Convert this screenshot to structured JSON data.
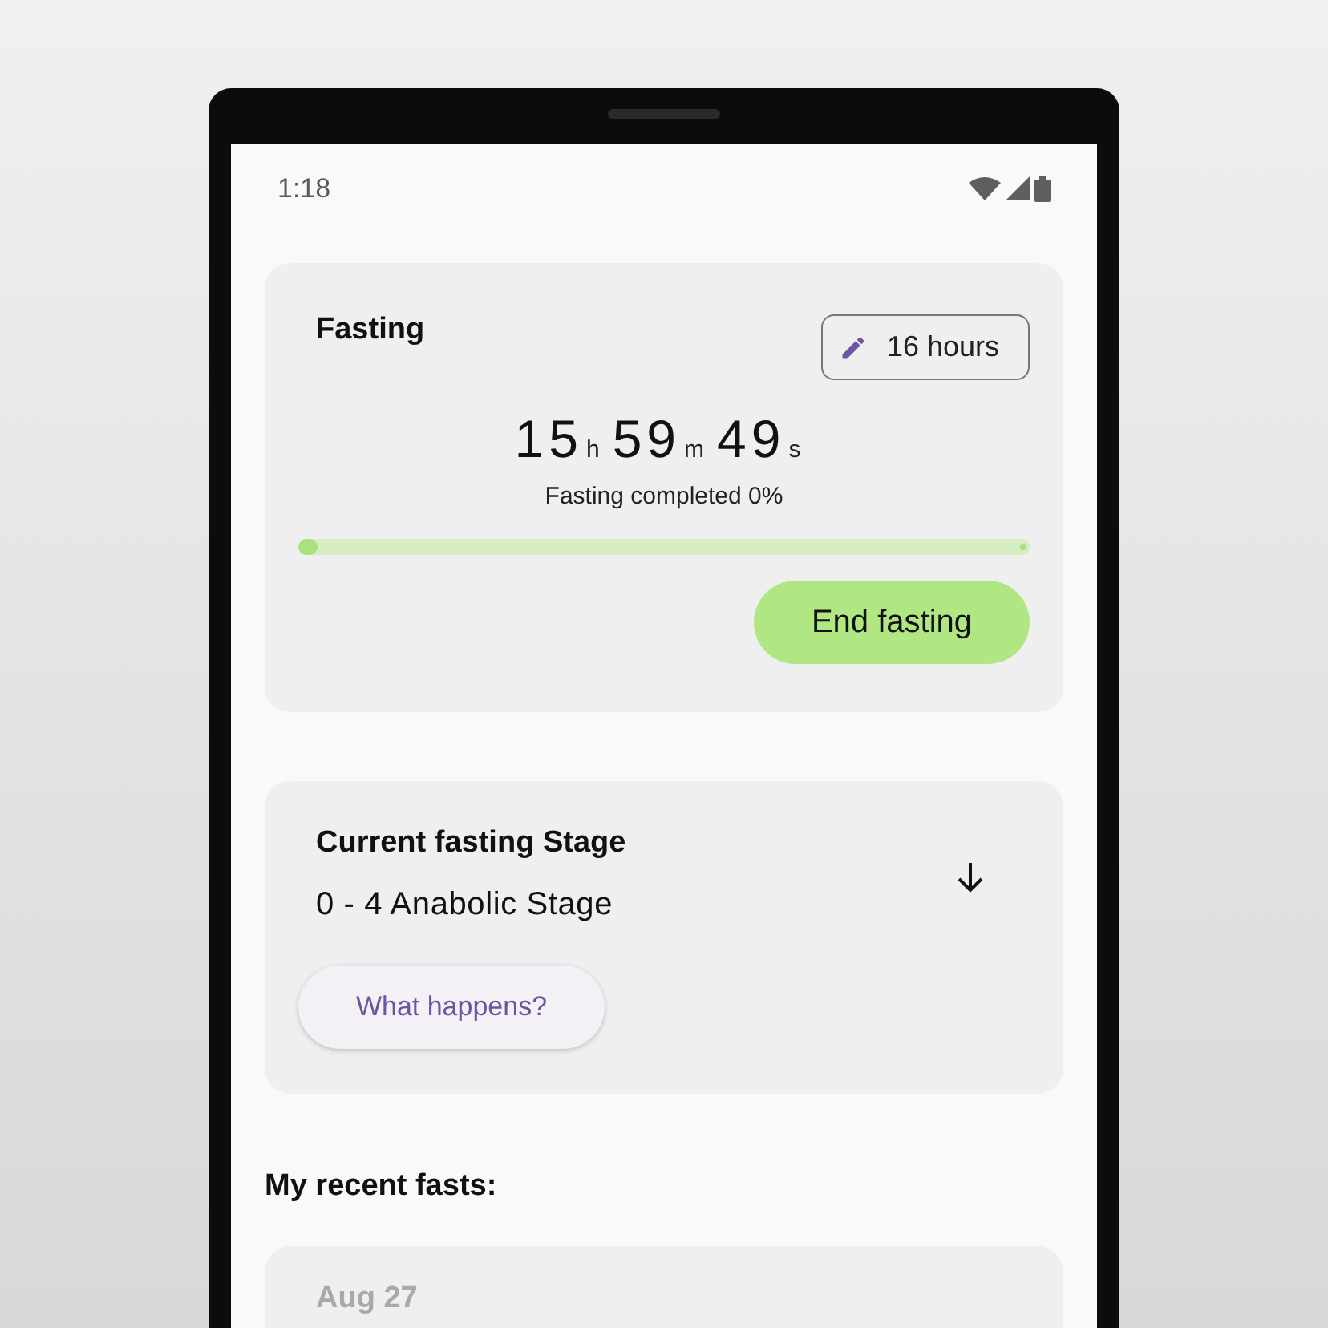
{
  "status_bar": {
    "time": "1:18"
  },
  "fasting_card": {
    "title": "Fasting",
    "goal_button": "16 hours",
    "timer": [
      {
        "value": "15",
        "unit": "h"
      },
      {
        "value": "59",
        "unit": "m"
      },
      {
        "value": "49",
        "unit": "s"
      }
    ],
    "progress_text": "Fasting completed 0%",
    "progress": {
      "level": 0
    },
    "end_button": "End fasting"
  },
  "stage_card": {
    "title": "Current fasting Stage",
    "stage": "0 - 4 Anabolic Stage",
    "expanded": false,
    "button": "What happens?"
  },
  "recent_title": "My recent fasts:",
  "recent_fasts": [
    {
      "date": "Aug 27"
    }
  ]
}
